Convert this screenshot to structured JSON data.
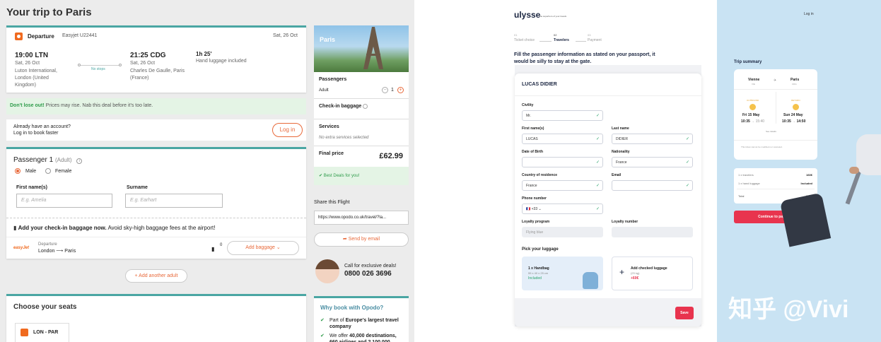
{
  "left": {
    "title": "Your trip to Paris",
    "departure": {
      "label": "Departure",
      "flight": "Easyjet U22441",
      "date": "Sat, 26 Oct",
      "dep_time": "19:00 LTN",
      "dep_date": "Sat, 26 Oct",
      "dep_place": "Luton International, London (United Kingdom)",
      "stops": "No stops",
      "arr_time": "21:25 CDG",
      "arr_date": "Sat, 26 Oct",
      "arr_place": "Charles De Gaulle, Paris (France)",
      "duration": "1h 25'",
      "baggage": "Hand luggage included"
    },
    "promo": {
      "strong": "Don't lose out!",
      "text": " Prices may rise. Nab this deal before it's too late."
    },
    "account": {
      "line1": "Already have an account?",
      "line2": "Log in to book faster",
      "login": "Log in"
    },
    "passenger": {
      "title": "Passenger 1",
      "type": "(Adult)",
      "male": "Male",
      "female": "Female",
      "first_label": "First name(s)",
      "first_ph": "E.g. Amelia",
      "sur_label": "Surname",
      "sur_ph": "E.g. Earhart"
    },
    "baggage": {
      "strong": "Add your check-in baggage now.",
      "text": " Avoid sky-high baggage fees at the airport!",
      "airline": "easyJet",
      "dep": "Departure",
      "route": "London ⟶ Paris",
      "count": "0",
      "add": "Add baggage"
    },
    "add_adult": "+ Add another adult",
    "seats": {
      "title": "Choose your seats",
      "route": "LON - PAR"
    },
    "sidebar": {
      "city": "Paris",
      "passengers": "Passengers",
      "adult": "Adult",
      "adult_count": "1",
      "checkin": "Check-in baggage",
      "services": "Services",
      "no_services": "No extra services selected",
      "final": "Final price",
      "price": "£62.99",
      "best": "Best Deals for you!",
      "share": "Share this Flight",
      "url": "https://www.opodo.co.uk/travel/?la...",
      "send": "Send by email",
      "call": "Call for exclusive deals!",
      "phone": "0800 026 3696",
      "why": "Why book with Opodo?",
      "why1_pre": "Part of ",
      "why1_b": "Europe's largest travel company",
      "why2_pre": "We offer ",
      "why2_b": "40,000 destinations, 660 airlines and 2,100,000"
    }
  },
  "right": {
    "logo": "ulysse",
    "tagline": "The superhero of your travels",
    "login": "Log in",
    "steps": [
      {
        "num": "01",
        "label": "Ticket choice"
      },
      {
        "num": "02",
        "label": "Travelers"
      },
      {
        "num": "03",
        "label": "Payment"
      }
    ],
    "intro": "Fill the passenger information as stated on your passport, it would be silly to stay at the gate.",
    "form": {
      "name": "LUCAS DIDIER",
      "civility_l": "Civility",
      "civility": "Mr.",
      "first_l": "First name(s)",
      "first": "LUCAS",
      "last_l": "Last name",
      "last": "DIDIER",
      "dob_l": "Date of Birth",
      "dob": "",
      "nat_l": "Nationality",
      "nat": "France",
      "country_l": "Country of residence",
      "country": "France",
      "email_l": "Email",
      "email": "",
      "phone_l": "Phone number",
      "flag": "🇫🇷",
      "code": "+33",
      "loyalty_l": "Loyalty program",
      "loyalty_ph": "Flying blue",
      "loyaltyn_l": "Loyalty number",
      "luggage_title": "Pick your luggage",
      "hand_title": "1 x Handbag",
      "hand_size": "55 x 40 x 25 cm",
      "hand_status": "Included",
      "checked_title": "Add checked luggage",
      "checked_weight": "(23 kg)",
      "checked_price": "+60€",
      "save": "Save"
    },
    "summary": {
      "title": "Trip summary",
      "from": "Vienne",
      "from_code": "VIE",
      "to": "Paris",
      "to_code": "CDG",
      "outbound": "OUTBOUND",
      "return": "RETURN",
      "d1": "Fri 15 May",
      "t1a": "10:35",
      "t1b": "15:40",
      "d2": "Sun 24 May",
      "t2a": "10:35",
      "t2b": "14:50",
      "see_details": "See details",
      "note": "This ticket cannot be modified nor canceled.",
      "rows": [
        {
          "label": "1 x travelers",
          "value": "160€"
        },
        {
          "label": "1 x hand luggage",
          "value": "Included"
        },
        {
          "label": "Total",
          "value": "160€"
        }
      ],
      "continue": "Continue to payment"
    },
    "watermark": "知乎 @Vivi"
  },
  "colors": {
    "teal": "#4aa6a3",
    "orange": "#e8693a",
    "pink": "#e8344e",
    "blue": "#c9e3f3",
    "green": "#2aa36b"
  }
}
